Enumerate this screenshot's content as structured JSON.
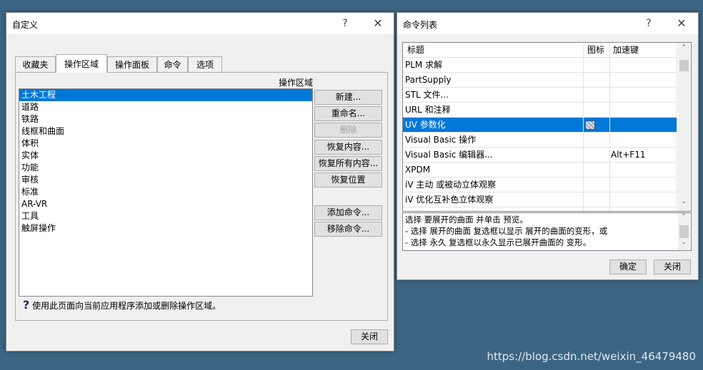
{
  "customize": {
    "title": "自定义",
    "help_btn": "?",
    "close_btn": "✕",
    "tabs": [
      "收藏夹",
      "操作区域",
      "操作面板",
      "命令",
      "选项"
    ],
    "active_tab": "操作区域",
    "list_label": "操作区域",
    "items": [
      "土木工程",
      "道路",
      "铁路",
      "线框和曲面",
      "体积",
      "实体",
      "功能",
      "审核",
      "标准",
      "AR-VR",
      "工具",
      "触屏操作"
    ],
    "selected_item": "土木工程",
    "buttons": {
      "new": "新建...",
      "rename": "重命名...",
      "delete": "删除",
      "restore_content": "恢复内容...",
      "restore_all": "恢复所有内容...",
      "restore_position": "恢复位置",
      "add_command": "添加命令...",
      "remove_command": "移除命令..."
    },
    "help_text": "使用此页面向当前应用程序添加或删除操作区域。",
    "close_label": "关闭"
  },
  "commands": {
    "title": "命令列表",
    "help_btn": "?",
    "close_btn": "✕",
    "columns": [
      "标题",
      "图标",
      "加速键"
    ],
    "rows": [
      {
        "title": "PLM 求解",
        "shortcut": ""
      },
      {
        "title": "PartSupply",
        "shortcut": ""
      },
      {
        "title": "STL 文件...",
        "shortcut": ""
      },
      {
        "title": "URL 和注释",
        "shortcut": ""
      },
      {
        "title": "UV 参数化",
        "shortcut": ""
      },
      {
        "title": "Visual Basic 操作",
        "shortcut": ""
      },
      {
        "title": "Visual Basic 编辑器...",
        "shortcut": "Alt+F11"
      },
      {
        "title": "XPDM",
        "shortcut": ""
      },
      {
        "title": "iV 主动 或被动立体观察",
        "shortcut": ""
      },
      {
        "title": "iV 优化互补色立体观察",
        "shortcut": ""
      }
    ],
    "selected_row": "UV 参数化",
    "description": [
      "选择 要展开的曲面 并单击 预览。",
      "-  选择 展开的曲面 复选框以显示 展开的曲面的变形，或",
      "-  选择 永久 复选框以永久显示已展开曲面的 变形。"
    ],
    "ok_label": "确定",
    "close_label": "关闭"
  },
  "watermark": "https://blog.csdn.net/weixin_46479480",
  "colors": {
    "selection": "#0078d7",
    "desktop": "#3c6584"
  }
}
